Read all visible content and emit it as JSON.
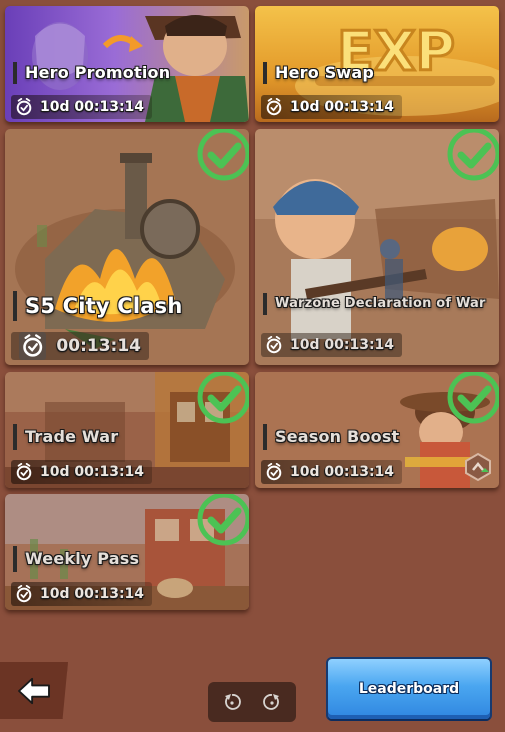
{
  "events": [
    {
      "id": "hero-promotion",
      "title": "Hero Promotion",
      "timer": "10d 00:13:14",
      "completed": false
    },
    {
      "id": "hero-swap",
      "title": "Hero Swap",
      "timer": "10d 00:13:14",
      "completed": false,
      "art_text": "EXP"
    },
    {
      "id": "city-clash",
      "title": "S5 City Clash",
      "timer": "00:13:14",
      "completed": true
    },
    {
      "id": "warzone",
      "title": "Warzone Declaration of War",
      "timer": "10d 00:13:14",
      "completed": true
    },
    {
      "id": "trade-war",
      "title": "Trade War",
      "timer": "10d 00:13:14",
      "completed": true
    },
    {
      "id": "season-boost",
      "title": "Season Boost",
      "timer": "10d 00:13:14",
      "completed": true
    },
    {
      "id": "weekly-pass",
      "title": "Weekly Pass",
      "timer": "10d 00:13:14",
      "completed": true
    }
  ],
  "footer": {
    "leaderboard_label": "Leaderboard"
  },
  "colors": {
    "background": "#8a4f3c",
    "check_green": "#4cc254",
    "leaderboard_blue": "#4aa6f0"
  },
  "icons": [
    "alarm-clock-icon",
    "check-circle-icon",
    "back-arrow-icon",
    "rotate-left-icon",
    "rotate-right-icon",
    "upgrade-badge-icon"
  ]
}
